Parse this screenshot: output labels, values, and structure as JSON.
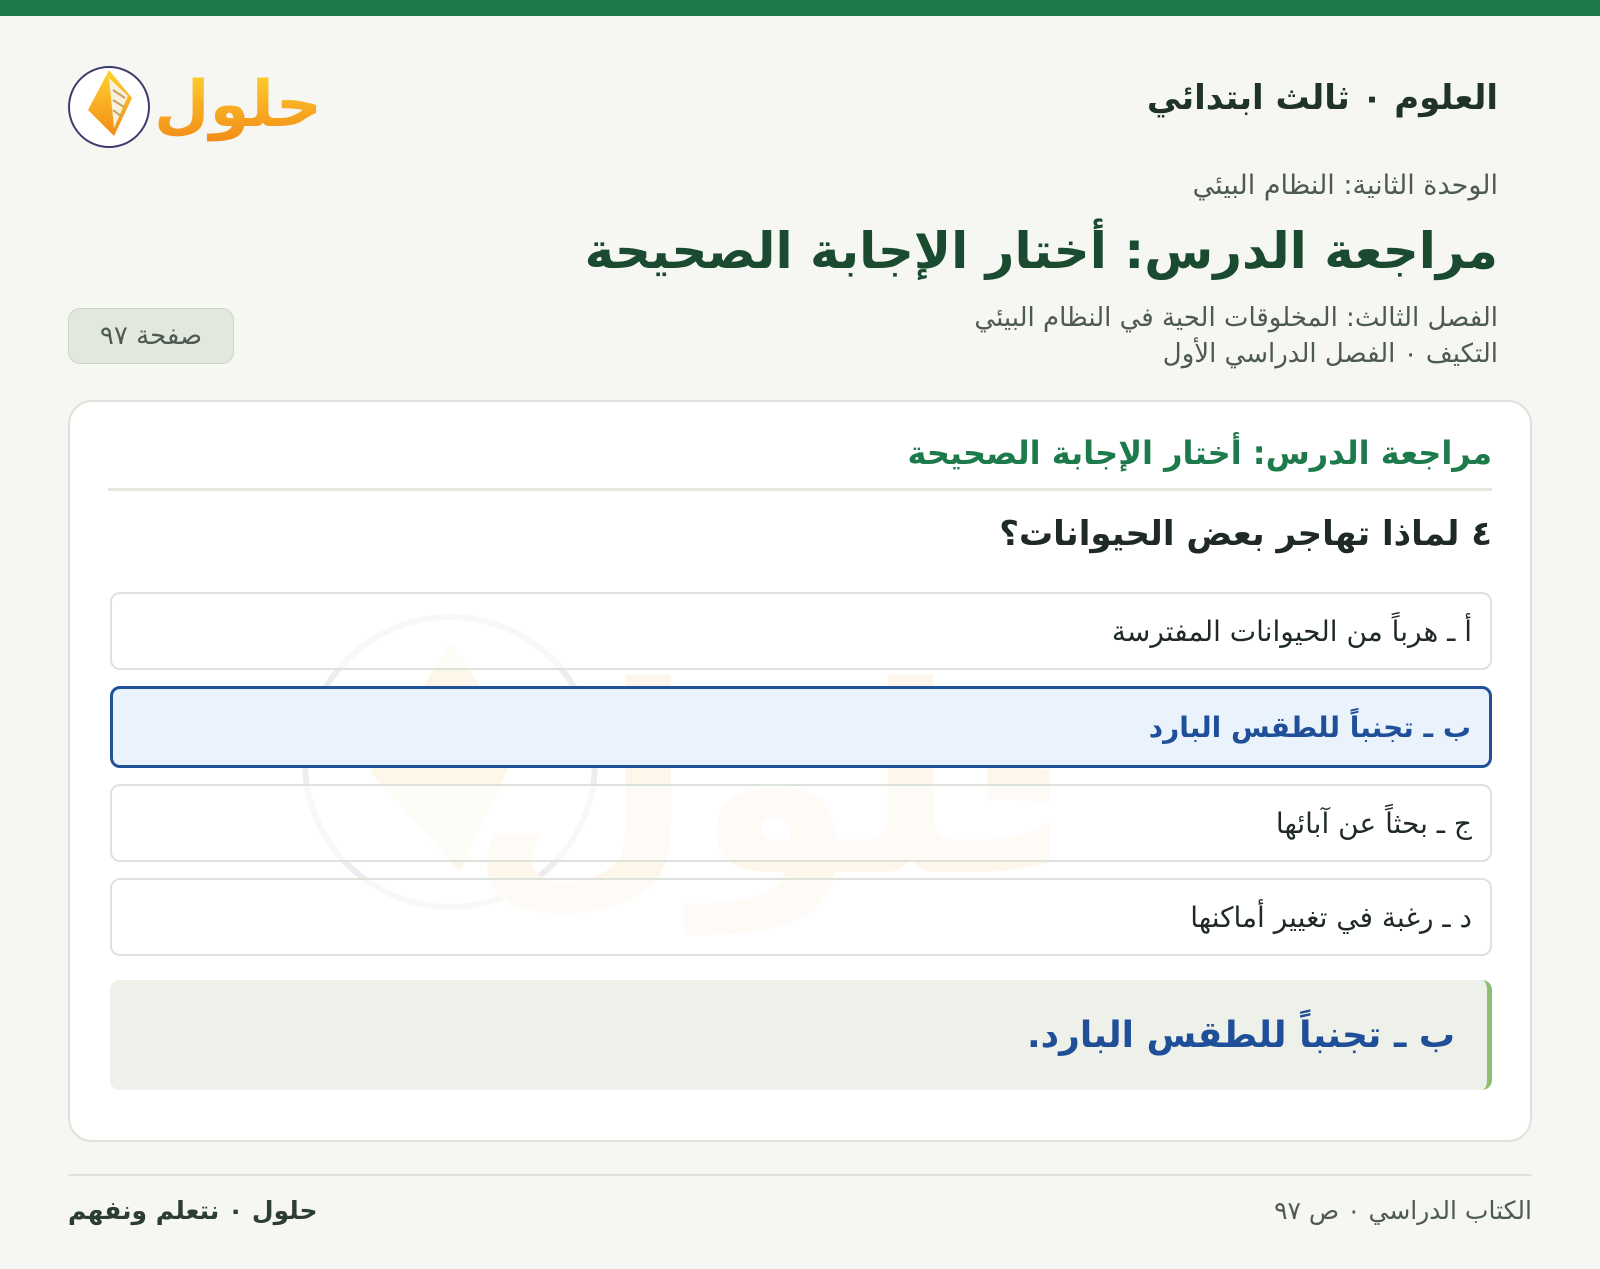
{
  "header": {
    "subject": "العلوم ٠ ثالث ابتدائي",
    "unit": "الوحدة الثانية: النظام البيئي",
    "page_title": "مراجعة الدرس: أختار الإجابة الصحيحة",
    "chapter": "الفصل الثالث: المخلوقات الحية في النظام البيئي",
    "lesson_term": "التكيف ٠ الفصل الدراسي الأول",
    "page_badge": "صفحة ٩٧",
    "logo_text": "حلول"
  },
  "card": {
    "title": "مراجعة الدرس: أختار الإجابة الصحيحة",
    "question": "٤ لماذا تهاجر بعض الحيوانات؟",
    "options": [
      {
        "label": "أ ـ هرباً من الحيوانات المفترسة",
        "selected": false
      },
      {
        "label": "ب ـ تجنباً للطقس البارد",
        "selected": true
      },
      {
        "label": "ج ـ بحثاً عن آبائها",
        "selected": false
      },
      {
        "label": "د ـ رغبة في تغيير أماكنها",
        "selected": false
      }
    ],
    "answer": "ب ـ تجنباً للطقس البارد."
  },
  "footer": {
    "source": "الكتاب الدراسي ٠ ص ٩٧",
    "brand": "حلول ٠ نتعلم ونفهم"
  },
  "colors": {
    "accent_green": "#1d7a4b",
    "selected_blue": "#1f5299",
    "logo_orange": "#f2a020"
  }
}
